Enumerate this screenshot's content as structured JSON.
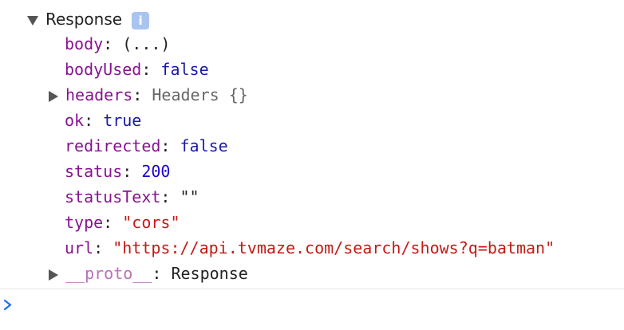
{
  "object": {
    "label": "Response",
    "info_badge": "i",
    "properties": [
      {
        "key": "body",
        "sep": ": ",
        "value": "(...)"
      },
      {
        "key": "bodyUsed",
        "sep": ": ",
        "value": "false"
      },
      {
        "key": "headers",
        "sep": ": ",
        "value": "Headers {}"
      },
      {
        "key": "ok",
        "sep": ": ",
        "value": "true"
      },
      {
        "key": "redirected",
        "sep": ": ",
        "value": "false"
      },
      {
        "key": "status",
        "sep": ": ",
        "value": "200"
      },
      {
        "key": "statusText",
        "sep": ": ",
        "value": "\"\""
      },
      {
        "key": "type",
        "sep": ": ",
        "value": "\"cors\""
      },
      {
        "key": "url",
        "sep": ": ",
        "value": "\"https://api.tvmaze.com/search/shows?q=batman\""
      },
      {
        "key": "__proto__",
        "sep": ": ",
        "value": "Response"
      }
    ]
  },
  "prompt": {
    "icon": "chevron-right-icon"
  },
  "colors": {
    "key": "#881391",
    "boolean": "#1a1aa6",
    "number": "#1c00cf",
    "string": "#c41a16",
    "badge": "#a9c4ef",
    "prompt": "#1a73e8"
  }
}
